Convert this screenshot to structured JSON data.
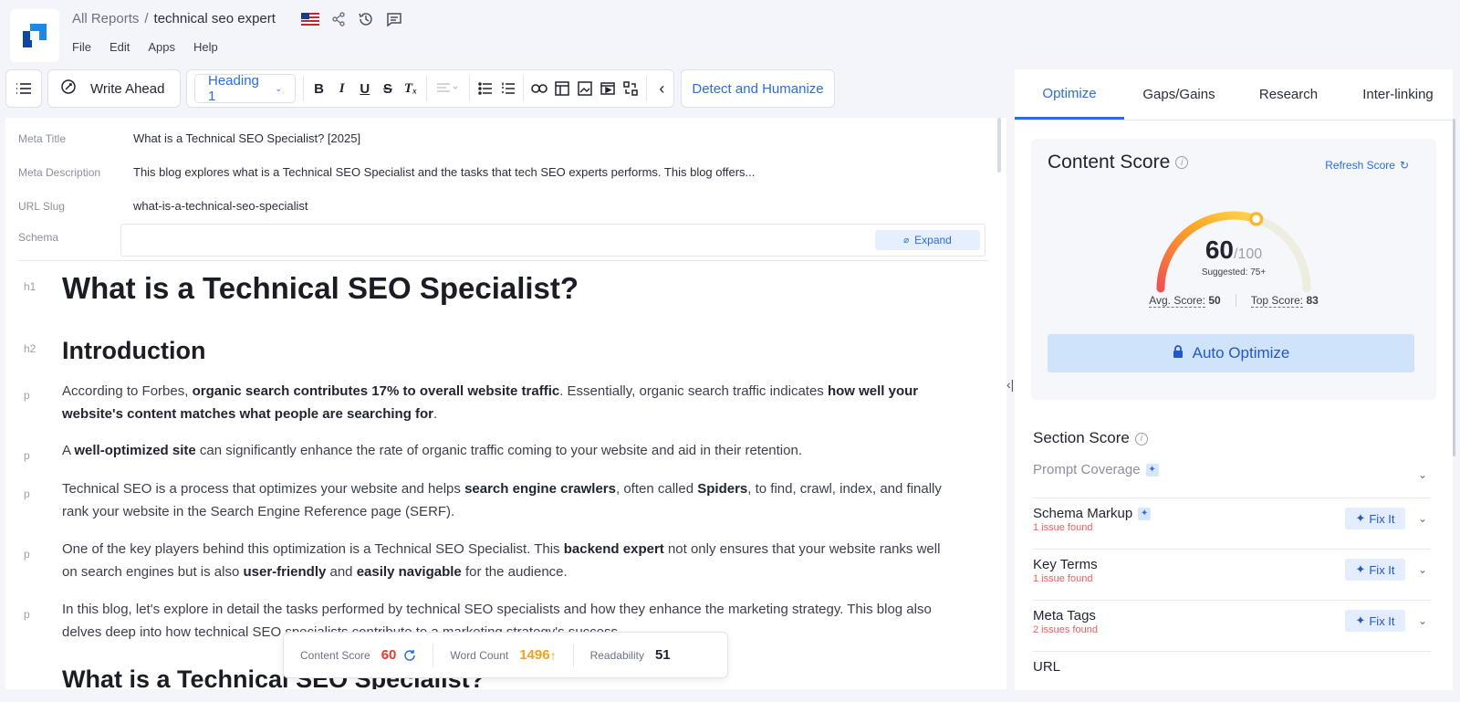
{
  "header": {
    "breadcrumb_root": "All Reports",
    "breadcrumb_sep": "/",
    "breadcrumb_current": "technical seo expert",
    "menu": [
      "File",
      "Edit",
      "Apps",
      "Help"
    ]
  },
  "toolbar": {
    "write_ahead": "Write Ahead",
    "heading_select": "Heading 1",
    "detect_humanize": "Detect and Humanize"
  },
  "meta": {
    "title_label": "Meta Title",
    "title_value": "What is a Technical SEO Specialist? [2025]",
    "desc_label": "Meta Description",
    "desc_value": "This blog explores what is a Technical SEO Specialist and the tasks that tech SEO experts performs. This blog offers...",
    "slug_label": "URL Slug",
    "slug_value": "what-is-a-technical-seo-specialist",
    "schema_label": "Schema",
    "expand_label": "Expand"
  },
  "document": {
    "h1_tag": "h1",
    "h1": "What is a Technical SEO Specialist?",
    "h2_tag": "h2",
    "h2": "Introduction",
    "p_tag": "p",
    "p1_a": "According to Forbes, ",
    "p1_b": "organic search contributes 17% to overall website traffic",
    "p1_c": ". Essentially, organic search traffic indicates ",
    "p1_d": "how well your website's content matches what people are searching for",
    "p1_e": ".",
    "p2_a": "A ",
    "p2_b": "well-optimized site",
    "p2_c": " can significantly enhance the rate of organic traffic coming to your website and aid in their retention.",
    "p3_a": "Technical SEO is a process that optimizes your website and helps ",
    "p3_b": "search engine crawlers",
    "p3_c": ", often called ",
    "p3_d": "Spiders",
    "p3_e": ", to find, crawl, index, and finally rank your website in the Search Engine Reference page (SERF).",
    "p4_a": "One of the key players behind this optimization is a Technical SEO Specialist. This ",
    "p4_b": "backend expert",
    "p4_c": " not only ensures that your website ranks well on search engines but is also ",
    "p4_d": "user-friendly",
    "p4_e": " and ",
    "p4_f": "easily navigable",
    "p4_g": " for the audience.",
    "p5": "In this blog, let's explore in detail the tasks performed by technical SEO specialists and how they enhance the marketing strategy. This blog also delves deep into how technical SEO specialists contribute to a marketing strategy's success.",
    "h2_next": "What is a Technical SEO Specialist?"
  },
  "stats_bar": {
    "content_score_label": "Content Score",
    "content_score_value": "60",
    "word_count_label": "Word Count",
    "word_count_value": "1496",
    "readability_label": "Readability",
    "readability_value": "51"
  },
  "panel": {
    "tabs": [
      "Optimize",
      "Gaps/Gains",
      "Research",
      "Inter-linking"
    ],
    "content_score_title": "Content Score",
    "refresh_label": "Refresh Score",
    "score": "60",
    "score_max": "/100",
    "score_fraction": 0.6,
    "suggested": "Suggested: 75+",
    "avg_label": "Avg. Score:",
    "avg_value": "50",
    "top_label": "Top Score:",
    "top_value": "83",
    "auto_optimize": "Auto Optimize",
    "section_score_title": "Section Score",
    "prompt_coverage": "Prompt Coverage",
    "sections": [
      {
        "name": "Schema Markup",
        "issue": "1 issue found",
        "fix": "Fix It"
      },
      {
        "name": "Key Terms",
        "issue": "1 issue found",
        "fix": "Fix It"
      },
      {
        "name": "Meta Tags",
        "issue": "2 issues found",
        "fix": "Fix It"
      },
      {
        "name": "URL",
        "issue": "",
        "fix": ""
      }
    ]
  },
  "colors": {
    "accent": "#2d6cdf",
    "score_red": "#e53935",
    "word_count_orange": "#f2a21b",
    "issue_red": "#ef5d5d"
  }
}
